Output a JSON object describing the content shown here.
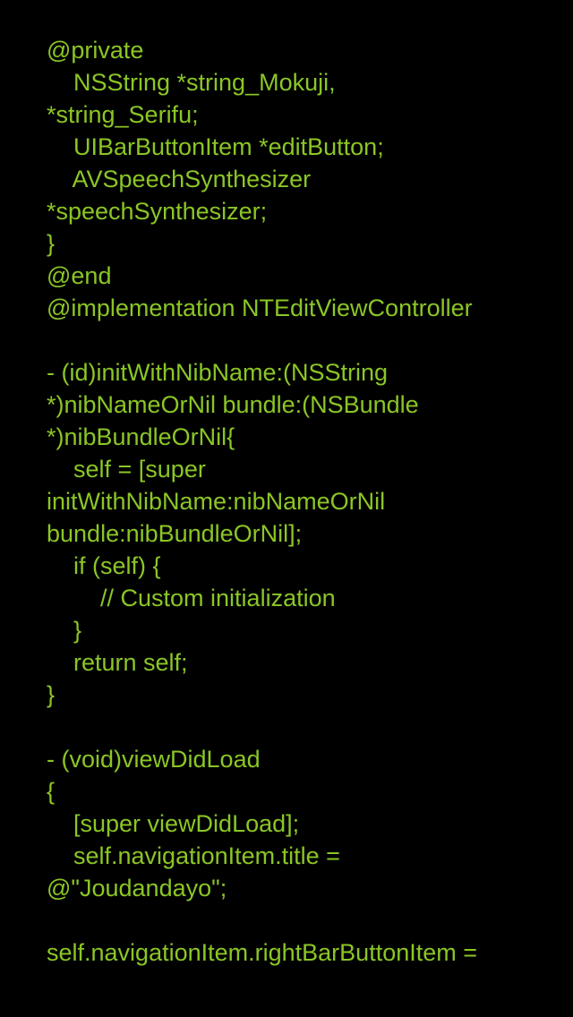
{
  "theme": {
    "background": "#000000",
    "text_color": "#8bc625"
  },
  "code": {
    "lines": [
      "@private",
      "    NSString *string_Mokuji,",
      "*string_Serifu;",
      "    UIBarButtonItem *editButton;",
      "    AVSpeechSynthesizer",
      "*speechSynthesizer;",
      "}",
      "@end",
      "@implementation NTEditViewController",
      "",
      "- (id)initWithNibName:(NSString",
      "*)nibNameOrNil bundle:(NSBundle",
      "*)nibBundleOrNil{",
      "    self = [super",
      "initWithNibName:nibNameOrNil",
      "bundle:nibBundleOrNil];",
      "    if (self) {",
      "        // Custom initialization",
      "    }",
      "    return self;",
      "}",
      "",
      "- (void)viewDidLoad",
      "{",
      "    [super viewDidLoad];",
      "    self.navigationItem.title =",
      "@\"Joudandayo\";",
      "",
      "self.navigationItem.rightBarButtonItem ="
    ]
  }
}
